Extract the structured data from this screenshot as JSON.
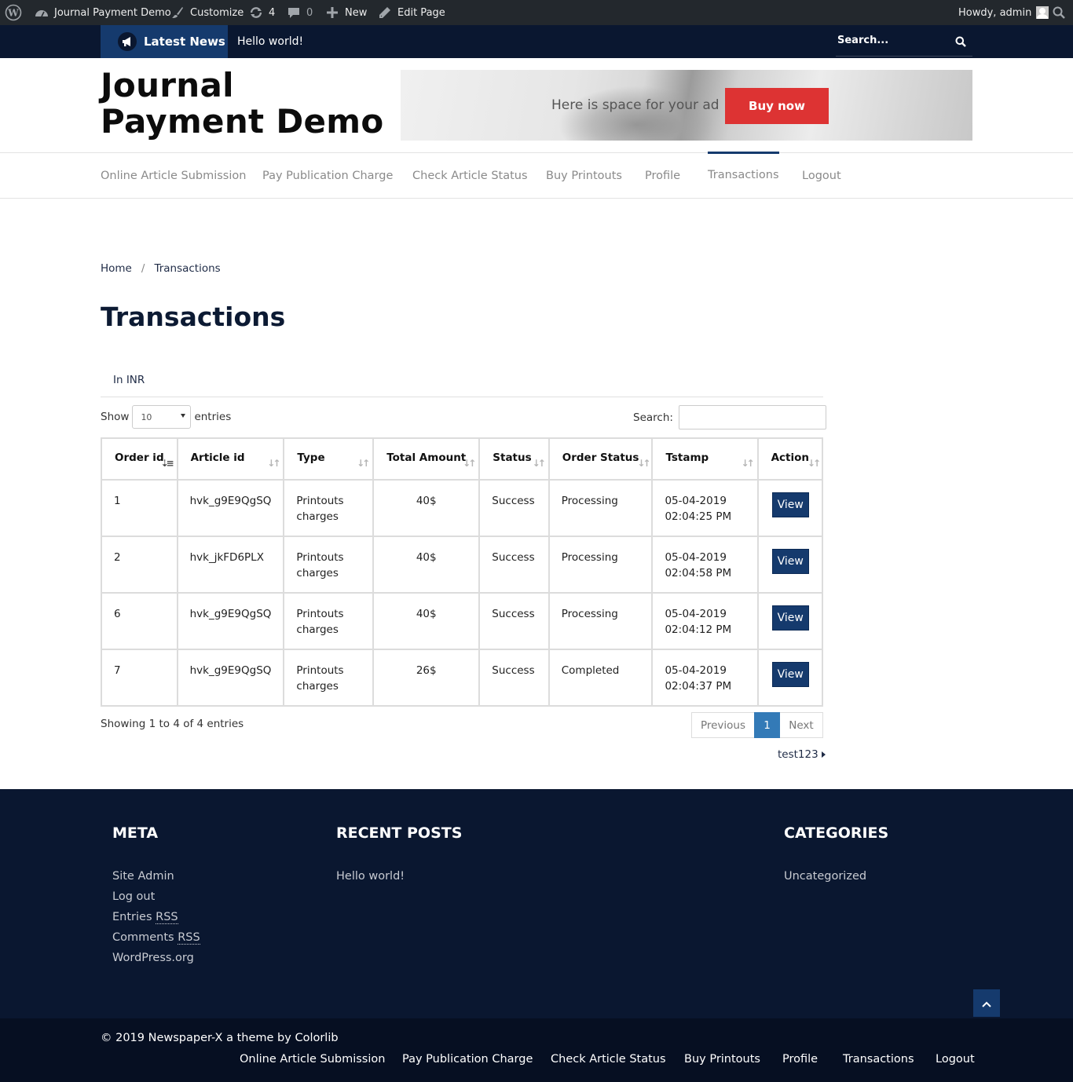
{
  "admin_bar": {
    "site_name": "Journal Payment Demo",
    "customize": "Customize",
    "updates_count": "4",
    "comments_count": "0",
    "new_label": "New",
    "edit_label": "Edit Page",
    "greeting": "Howdy, admin"
  },
  "ticker": {
    "label": "Latest News",
    "headline": "Hello world!",
    "search_placeholder": "Search..."
  },
  "header": {
    "site_title": "Journal Payment Demo",
    "ad_text": "Here is space for your ad",
    "ad_button": "Buy now"
  },
  "nav": {
    "items": [
      {
        "label": "Online Article Submission"
      },
      {
        "label": "Pay Publication Charge"
      },
      {
        "label": "Check Article Status"
      },
      {
        "label": "Buy Printouts"
      },
      {
        "label": "Profile"
      },
      {
        "label": "Transactions"
      },
      {
        "label": "Logout"
      }
    ],
    "active": "Transactions"
  },
  "breadcrumb": {
    "home": "Home",
    "separator": "/",
    "current": "Transactions"
  },
  "page_title": "Transactions",
  "currency_tab": "In INR",
  "table_controls": {
    "show_label": "Show",
    "entries_value": "10",
    "entries_label": "entries",
    "search_label": "Search:"
  },
  "table": {
    "headers": [
      "Order id",
      "Article id",
      "Type",
      "Total Amount",
      "Status",
      "Order Status",
      "Tstamp",
      "Action"
    ],
    "rows": [
      {
        "order_id": "1",
        "article_id": "hvk_g9E9QgSQ",
        "type_1": "Printouts",
        "type_2": "charges",
        "amount": "40$",
        "status": "Success",
        "order_status": "Processing",
        "date": "05-04-2019",
        "time": "02:04:25 PM",
        "action": "View"
      },
      {
        "order_id": "2",
        "article_id": "hvk_jkFD6PLX",
        "type_1": "Printouts",
        "type_2": "charges",
        "amount": "40$",
        "status": "Success",
        "order_status": "Processing",
        "date": "05-04-2019",
        "time": "02:04:58 PM",
        "action": "View"
      },
      {
        "order_id": "6",
        "article_id": "hvk_g9E9QgSQ",
        "type_1": "Printouts",
        "type_2": "charges",
        "amount": "40$",
        "status": "Success",
        "order_status": "Processing",
        "date": "05-04-2019",
        "time": "02:04:12 PM",
        "action": "View"
      },
      {
        "order_id": "7",
        "article_id": "hvk_g9E9QgSQ",
        "type_1": "Printouts",
        "type_2": "charges",
        "amount": "26$",
        "status": "Success",
        "order_status": "Completed",
        "date": "05-04-2019",
        "time": "02:04:37 PM",
        "action": "View"
      }
    ]
  },
  "pagination": {
    "info": "Showing 1 to 4 of 4 entries",
    "previous": "Previous",
    "current": "1",
    "next": "Next"
  },
  "user_link": "test123",
  "footer": {
    "meta_title": "META",
    "meta_links": {
      "site_admin": "Site Admin",
      "log_out": "Log out",
      "entries": "Entries",
      "comments": "Comments",
      "rss": "RSS",
      "wordpress": "WordPress.org"
    },
    "recent_title": "RECENT POSTS",
    "recent_posts": [
      "Hello world!"
    ],
    "categories_title": "CATEGORIES",
    "categories": [
      "Uncategorized"
    ]
  },
  "bottom_bar": {
    "copyright": "© 2019 Newspaper-X a theme by Colorlib"
  },
  "colors": {
    "dark_navy": "#0a1730",
    "brand_blue": "#153a6d",
    "ad_red": "#dd3333",
    "pager_blue": "#337ab7"
  }
}
